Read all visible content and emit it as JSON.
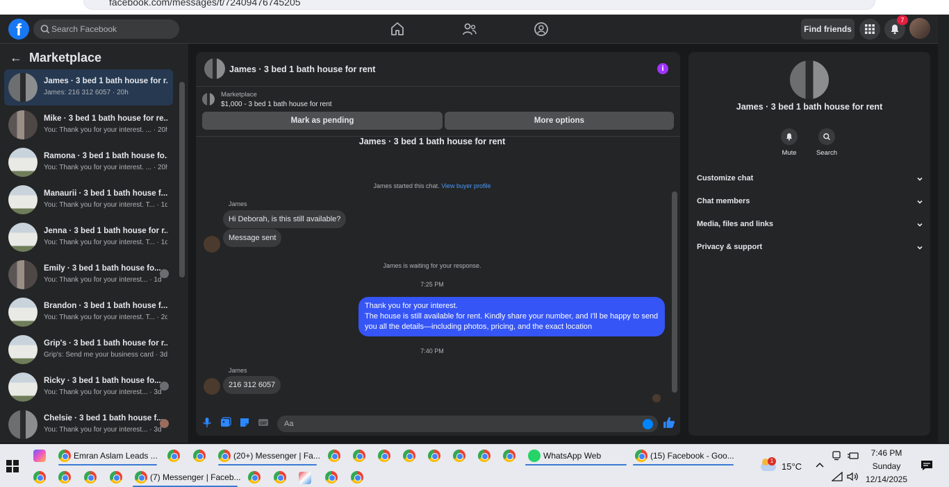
{
  "browser": {
    "url": "facebook.com/messages/t/72409476745205"
  },
  "header": {
    "logo": "f",
    "search_placeholder": "Search Facebook",
    "find_friends": "Find friends",
    "notification_count": "7"
  },
  "sidebar": {
    "title": "Marketplace",
    "conversations": [
      {
        "name": "James · 3 bed 1 bath house for r...",
        "preview": "James: 216 312 6057 · 20h",
        "active": true
      },
      {
        "name": "Mike · 3 bed 1 bath house for re...",
        "preview": "You: Thank you for your interest. ... · 20h"
      },
      {
        "name": "Ramona · 3 bed 1 bath house fo...",
        "preview": "You: Thank you for your interest. ... · 20h"
      },
      {
        "name": "Manaurii · 3 bed 1 bath house f...",
        "preview": "You: Thank you for your interest. T... · 1d"
      },
      {
        "name": "Jenna · 3 bed 1 bath house for r...",
        "preview": "You: Thank you for your interest. T... · 1d"
      },
      {
        "name": "Emily · 3 bed 1 bath house fo...",
        "preview": "You: Thank you for your interest... · 1d"
      },
      {
        "name": "Brandon · 3 bed 1 bath house f...",
        "preview": "You: Thank you for your interest. T... · 2d"
      },
      {
        "name": "Grip's · 3 bed 1 bath house for r...",
        "preview": "Grip's: Send me your business card · 3d"
      },
      {
        "name": "Ricky · 3 bed 1 bath house fo...",
        "preview": "You: Thank you for your interest... · 3d"
      },
      {
        "name": "Chelsie · 3 bed 1 bath house f...",
        "preview": "You: Thank you for your interest... · 3d"
      }
    ]
  },
  "chat": {
    "title": "James · 3 bed 1 bath house for rent",
    "marketplace_label": "Marketplace",
    "listing": "$1,000 - 3 bed 1 bath house for rent",
    "mark_pending": "Mark as pending",
    "more_options": "More options",
    "thread_header": "James · 3 bed 1 bath house for rent",
    "started_text": "James started this chat.",
    "view_profile": "View buyer profile",
    "sender1": "James",
    "msg1": "Hi Deborah, is this still available?",
    "msg2": "Message sent",
    "waiting": "James is waiting for your response.",
    "time1": "7:25 PM",
    "out_line1": "Thank you for your interest.",
    "out_line2": "The house is still available for rent. Kindly share your number, and I'll be happy to send you all the details—including photos, pricing, and the exact location",
    "time2": "7:40 PM",
    "sender2": "James",
    "msg3": "216 312 6057",
    "compose_placeholder": "Aa"
  },
  "details": {
    "name": "James · 3 bed 1 bath house for rent",
    "mute": "Mute",
    "search": "Search",
    "sections": [
      "Customize chat",
      "Chat members",
      "Media, files and links",
      "Privacy & support"
    ]
  },
  "taskbar": {
    "items": [
      "Emran Aslam Leads ...",
      "(20+) Messenger | Fa...",
      "WhatsApp Web",
      "(15) Facebook - Goo...",
      "(7) Messenger | Faceb..."
    ],
    "temperature": "15°C",
    "time": "7:46 PM",
    "day": "Sunday",
    "date": "12/14/2025",
    "weather_badge": "1"
  }
}
